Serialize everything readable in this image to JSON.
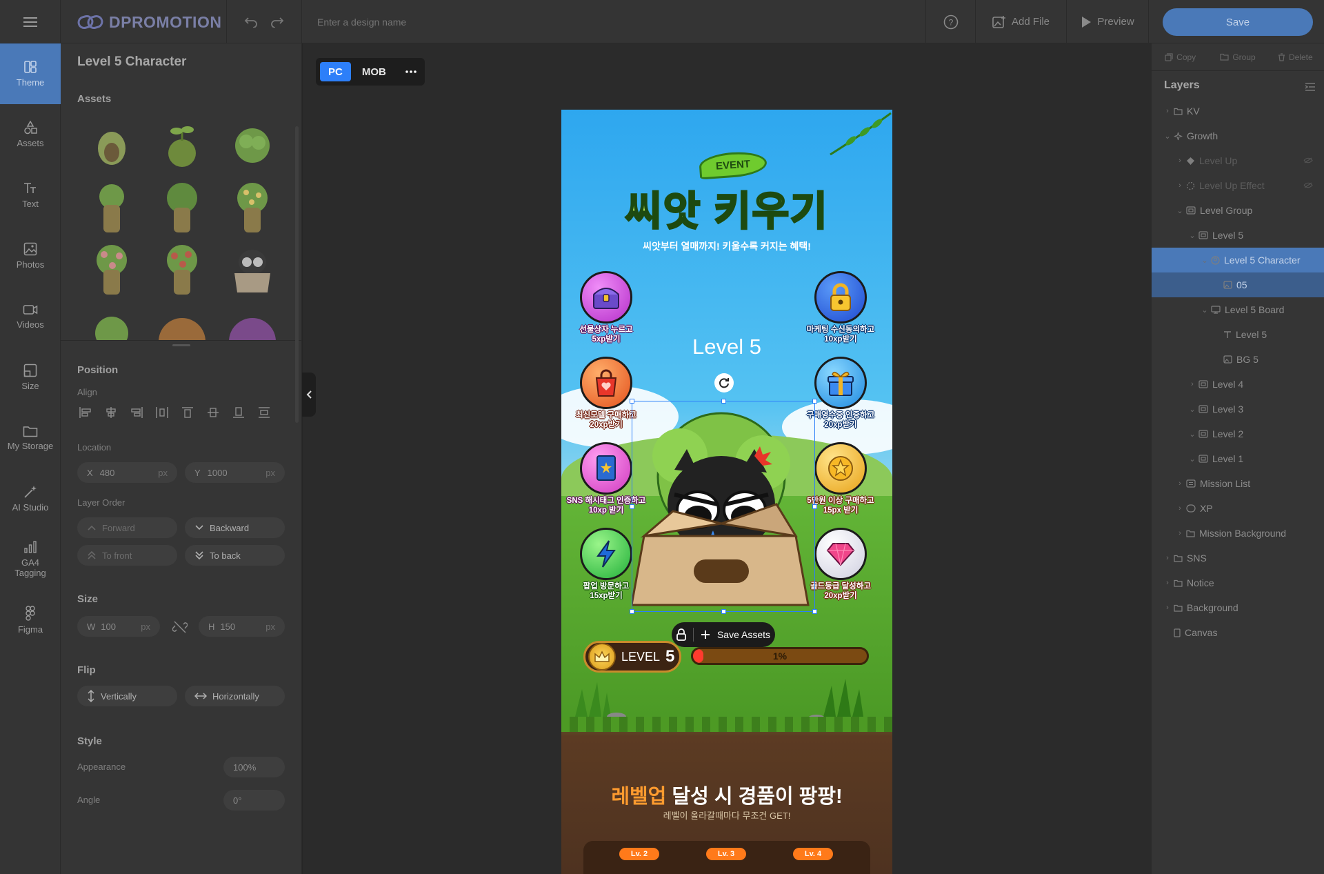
{
  "topbar": {
    "logo_text": "DPROMOTION",
    "design_name_placeholder": "Enter a design name",
    "add_file_label": "Add File",
    "preview_label": "Preview",
    "save_label": "Save"
  },
  "leftnav": {
    "items": [
      {
        "label": "Theme",
        "icon": "theme-icon"
      },
      {
        "label": "Assets",
        "icon": "shapes-icon"
      },
      {
        "label": "Text",
        "icon": "text-icon"
      },
      {
        "label": "Photos",
        "icon": "photo-icon"
      },
      {
        "label": "Videos",
        "icon": "video-icon"
      },
      {
        "label": "Size",
        "icon": "size-icon"
      },
      {
        "label": "My Storage",
        "icon": "folder-icon"
      },
      {
        "label": "AI Studio",
        "icon": "magic-wand-icon"
      },
      {
        "label": "GA4 Tagging",
        "icon": "analytics-icon"
      },
      {
        "label": "Figma",
        "icon": "figma-icon"
      }
    ]
  },
  "leftpanel": {
    "title": "Level 5 Character",
    "assets_label": "Assets",
    "position_label": "Position",
    "align_label": "Align",
    "location_label": "Location",
    "x_label": "X",
    "x_value": "480",
    "y_label": "Y",
    "y_value": "1000",
    "px": "px",
    "layer_order_label": "Layer Order",
    "forward": "Forward",
    "backward": "Backward",
    "to_front": "To front",
    "to_back": "To back",
    "size_label": "Size",
    "w_label": "W",
    "w_value": "100",
    "h_label": "H",
    "h_value": "150",
    "flip_label": "Flip",
    "vertically": "Vertically",
    "horizontally": "Horizontally",
    "style_label": "Style",
    "appearance_label": "Appearance",
    "appearance_value": "100%",
    "angle_label": "Angle",
    "angle_value": "0°"
  },
  "canvas": {
    "device_pc": "PC",
    "device_mob": "MOB",
    "event_badge": "EVENT",
    "main_title": "씨앗 키우기",
    "subtitle": "씨앗부터 열매까지! 키울수록 커지는 혜택!",
    "level_heading": "Level 5",
    "missions": [
      {
        "line1": "선물상자 누르고",
        "line2": "5xp받기",
        "icon": "treasure-chest-icon",
        "color": "#c640d8"
      },
      {
        "line1": "마케팅 수신동의하고",
        "line2": "10xp받기",
        "icon": "padlock-icon",
        "color": "#1f5ae0"
      },
      {
        "line1": "최신모델 구매하고",
        "line2": "20xp받기",
        "icon": "shopping-bag-icon",
        "color": "#ef6a2a"
      },
      {
        "line1": "구매영수증 인증하고",
        "line2": "20xp받기",
        "icon": "gift-box-icon",
        "color": "#2aa8ef"
      },
      {
        "line1": "SNS 해시태그 인증하고",
        "line2": "10xp 받기",
        "icon": "book-icon",
        "color": "#e052c8"
      },
      {
        "line1": "5만원 이상 구매하고",
        "line2": "15px 받기",
        "icon": "star-coin-icon",
        "color": "#f2b526"
      },
      {
        "line1": "팝업 방문하고",
        "line2": "15xp받기",
        "icon": "lightning-icon",
        "color": "#36c94a"
      },
      {
        "line1": "골드등급 달성하고",
        "line2": "20xp받기",
        "icon": "gem-icon",
        "color": "#e8e8f0"
      }
    ],
    "save_assets": "Save Assets",
    "level_word": "LEVEL",
    "level_number": "5",
    "progress_percent": 1,
    "progress_text": "1%",
    "promo_highlight": "레벨업",
    "promo_rest": " 달성 시 경품이 팡팡!",
    "promo_sub": "레벨이 올라갈때마다 무조건 GET!",
    "lv_tags": [
      "Lv. 2",
      "Lv. 3",
      "Lv. 4"
    ]
  },
  "rightpanel": {
    "copy": "Copy",
    "group": "Group",
    "delete": "Delete",
    "layers_title": "Layers",
    "layers": [
      {
        "name": "KV",
        "indent": 0,
        "chev": "›",
        "icon": "folder-icon",
        "state": ""
      },
      {
        "name": "Growth",
        "indent": 0,
        "chev": "⌄",
        "icon": "sparkle-icon",
        "state": ""
      },
      {
        "name": "Level Up",
        "indent": 1,
        "chev": "›",
        "icon": "shape-icon",
        "state": "dim"
      },
      {
        "name": "Level Up Effect",
        "indent": 1,
        "chev": "›",
        "icon": "effect-icon",
        "state": "dim"
      },
      {
        "name": "Level Group",
        "indent": 1,
        "chev": "⌄",
        "icon": "group-icon",
        "state": ""
      },
      {
        "name": "Level 5",
        "indent": 2,
        "chev": "⌄",
        "icon": "group-icon",
        "state": ""
      },
      {
        "name": "Level 5 Character",
        "indent": 3,
        "chev": "⌄",
        "icon": "character-icon",
        "state": "sel"
      },
      {
        "name": "05",
        "indent": 4,
        "chev": "",
        "icon": "image-icon",
        "state": "sel2"
      },
      {
        "name": "Level 5 Board",
        "indent": 3,
        "chev": "⌄",
        "icon": "board-icon",
        "state": ""
      },
      {
        "name": "Level 5",
        "indent": 4,
        "chev": "",
        "icon": "text-icon",
        "state": ""
      },
      {
        "name": "BG 5",
        "indent": 4,
        "chev": "",
        "icon": "image-icon",
        "state": ""
      },
      {
        "name": "Level 4",
        "indent": 2,
        "chev": "›",
        "icon": "group-icon",
        "state": ""
      },
      {
        "name": "Level 3",
        "indent": 2,
        "chev": "⌄",
        "icon": "group-icon",
        "state": ""
      },
      {
        "name": "Level 2",
        "indent": 2,
        "chev": "⌄",
        "icon": "group-icon",
        "state": ""
      },
      {
        "name": "Level 1",
        "indent": 2,
        "chev": "⌄",
        "icon": "group-icon",
        "state": ""
      },
      {
        "name": "Mission List",
        "indent": 1,
        "chev": "›",
        "icon": "list-icon",
        "state": ""
      },
      {
        "name": "XP",
        "indent": 1,
        "chev": "›",
        "icon": "xp-icon",
        "state": ""
      },
      {
        "name": "Mission Background",
        "indent": 1,
        "chev": "›",
        "icon": "folder-icon",
        "state": ""
      },
      {
        "name": "SNS",
        "indent": 0,
        "chev": "›",
        "icon": "folder-icon",
        "state": ""
      },
      {
        "name": "Notice",
        "indent": 0,
        "chev": "›",
        "icon": "folder-icon",
        "state": ""
      },
      {
        "name": "Background",
        "indent": 0,
        "chev": "›",
        "icon": "folder-icon",
        "state": ""
      },
      {
        "name": "Canvas",
        "indent": 0,
        "chev": "",
        "icon": "canvas-icon",
        "state": ""
      }
    ]
  }
}
